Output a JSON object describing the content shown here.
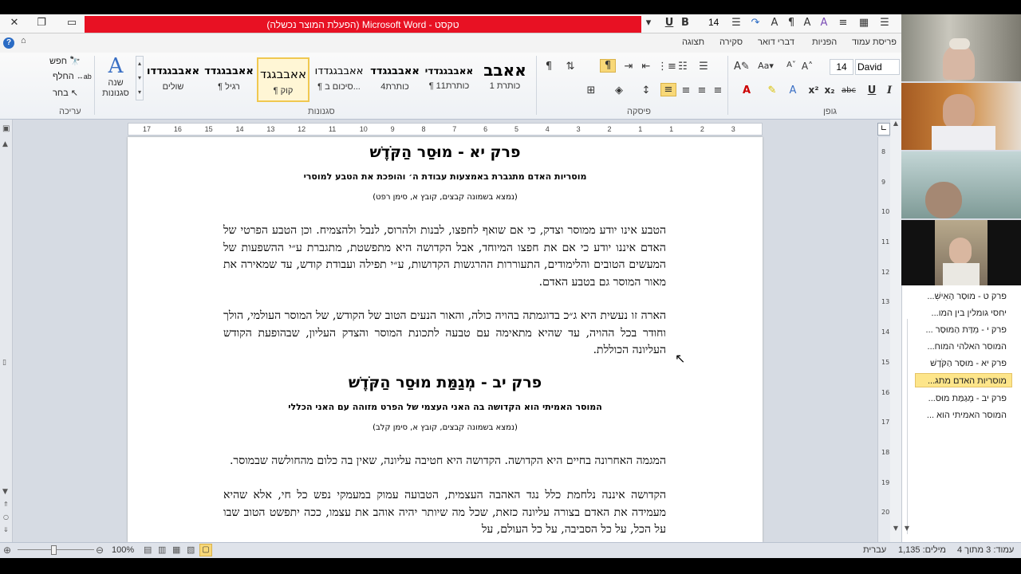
{
  "window": {
    "title": "טקסט - Microsoft Word (הפעלת המוצר נכשלה)"
  },
  "quick_access": {
    "font_size": "14"
  },
  "tabs": [
    "פריסת עמוד",
    "הפניות",
    "דברי דואר",
    "סקירה",
    "תצוגה"
  ],
  "ribbon": {
    "groups": {
      "font": "גופן",
      "paragraph": "פיסקה",
      "styles": "סגנונות",
      "editing": "עריכה"
    },
    "font_name": "David",
    "font_size": "14",
    "styles": [
      {
        "preview": "אאבב",
        "name": "כותרת 1"
      },
      {
        "preview": "אאבבגגדדי",
        "name": "¶ כותרת11"
      },
      {
        "preview": "אאבבגגדד",
        "name": "כותרת4"
      },
      {
        "preview": "אאבבגגדדו",
        "name": "¶ סיכום ב..."
      },
      {
        "preview": "אאבבגגד",
        "name": "¶ קוק"
      },
      {
        "preview": "אאבבגגדד",
        "name": "¶ רגיל"
      },
      {
        "preview": "אאבבגגדדו",
        "name": "שולים"
      }
    ],
    "change_styles": "שנה סגנונות",
    "editing": {
      "find": "חפש",
      "replace": "החלף",
      "select": "בחר"
    }
  },
  "ruler": {
    "numbers": [
      "17",
      "16",
      "15",
      "14",
      "13",
      "12",
      "11",
      "10",
      "9",
      "8",
      "7",
      "6",
      "5",
      "4",
      "3",
      "2",
      "1",
      "1",
      "2",
      "3"
    ]
  },
  "vruler": {
    "numbers": [
      "8",
      "9",
      "10",
      "11",
      "12",
      "13",
      "14",
      "15",
      "16",
      "17",
      "18",
      "19",
      "20"
    ]
  },
  "document": {
    "chapter1_title": "פרק יא - מוּסַר הַקֹּדֶשׁ",
    "chapter1_subtitle": "מוסריות האדם מתגברת באמצעות עבודת ה׳ והופכת את הטבע למוסרי",
    "chapter1_source": "(נמצא בשמונה קבצים, קובץ א, סימן רפט)",
    "chapter1_para1": "הטבע אינו יודע ממוסר וצדק, כי אם שואף לחפצו, לבנות ולהרוס, לנבל ולהצמיח. וכן הטבע הפרטי של האדם איננו יודע כי אם את חפצו המיוחד, אבל הקדושה היא מתפשטת, מתגברת ע״י ההשפעות של המעשים הטובים והלימודים, התעוררות ההרגשות הקדושות, ע״י תפילה ועבודת קודש, עד שמאירה את מאור המוסר גם בטבע האדם.",
    "chapter1_para2": "הארה זו נעשית היא ג״כ בדוגמתה בהויה כולה, והאור הנעים הטוב של הקודש, של המוסר העולמי, הולך וחודר בכל ההויה, עד שהיא מתאימה עם טבעה לתכונת המוסר והצדק העליון, שבהופעת הקודש העליונה הכוללת.",
    "chapter2_title": "פרק יב - מְגַמַּת מוּסַר הַקֹּדֶשׁ",
    "chapter2_subtitle": "המוסר האמיתי הוא הקדושה בה האני העצמי של הפרט מזוהה עם האני הכללי",
    "chapter2_source": "(נמצא בשמונה קבצים, קובץ א, סימן קלב)",
    "chapter2_para1": "המגמה האחרונה בחיים היא הקדושה. הקדושה היא חטיבה עליונה, שאין בה כלום מהחולשה שבמוסר.",
    "chapter2_para2": "הקדושה איננה נלחמת כלל נגד האהבה העצמית, הטבועה עמוק במעמקי נפש כל חי, אלא שהיא מעמידה את האדם בצורה עליונה כזאת, שכל מה שיותר יהיה אוהב את עצמו, ככה יתפשט הטוב שבו על הכל, על כל הסביבה, על כל העולם, על"
  },
  "nav_pane": {
    "items": [
      {
        "label": "פרק ט - מוּסַר הָאִישִׁ...",
        "selected": false
      },
      {
        "label": "יחסי גומלין בין המו...",
        "selected": false
      },
      {
        "label": "פרק י - מִדַּת הַמּוּסַר ...",
        "selected": false
      },
      {
        "label": "המוסר האלהי המוח...",
        "selected": false
      },
      {
        "label": "פרק יא - מוּסַר הַקֹּדֶשׁ",
        "selected": false
      },
      {
        "label": "מוסריות האדם מתג...",
        "selected": true
      },
      {
        "label": "פרק יב - מְגַמַּת מוּס...",
        "selected": false
      },
      {
        "label": "המוסר האמיתי הוא ...",
        "selected": false
      }
    ]
  },
  "status_bar": {
    "page": "עמוד: 3 מתוך 4",
    "words": "מילים: 1,135",
    "language": "עברית",
    "zoom": "100%"
  }
}
